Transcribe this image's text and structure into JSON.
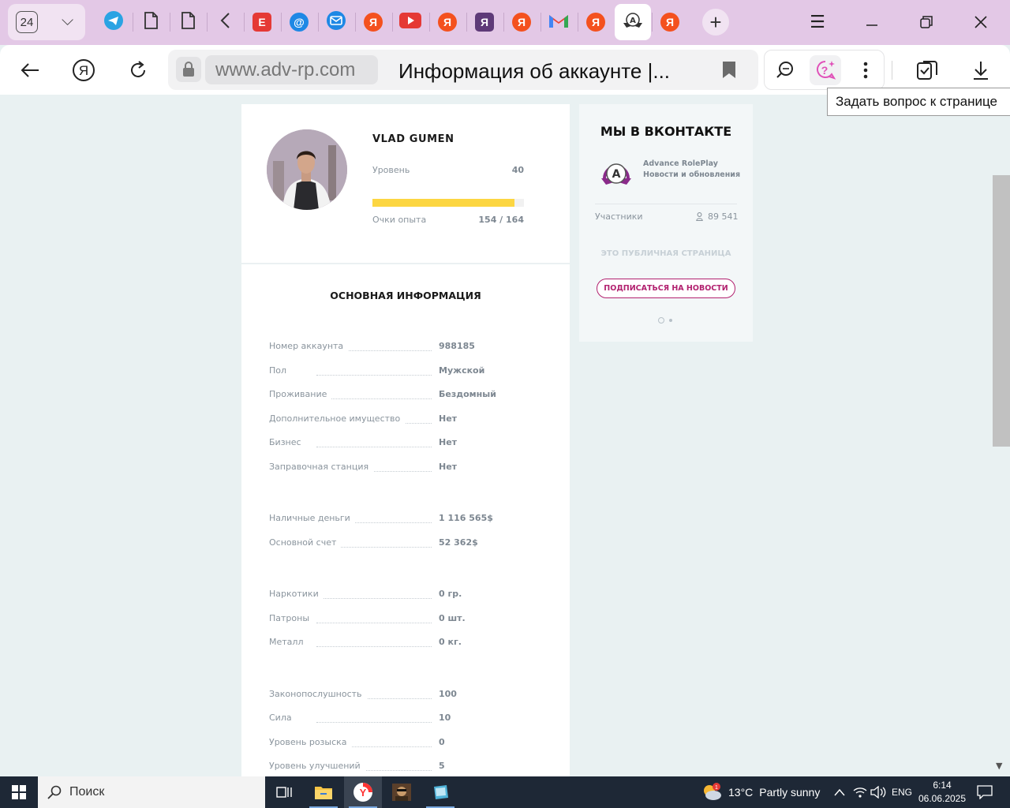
{
  "browser": {
    "tab_count": "24",
    "url": "www.adv-rp.com",
    "page_title": "Информация об аккаунте |...",
    "tooltip": "Задать вопрос к странице",
    "tabs": [
      {
        "icon": "telegram-icon",
        "color": "#2aa3e3"
      },
      {
        "icon": "document-icon",
        "color": "#333333"
      },
      {
        "icon": "document-icon",
        "color": "#333333"
      },
      {
        "icon": "back-chevron-icon",
        "color": "#333333"
      },
      {
        "icon": "e-letter-icon",
        "color": "#e53935",
        "glyph": "E"
      },
      {
        "icon": "at-sign-icon",
        "color": "#1e88e5",
        "glyph": "@"
      },
      {
        "icon": "mail-icon",
        "color": "#1e88e5"
      },
      {
        "icon": "yandex-icon",
        "color": "#f4511e",
        "glyph": "Я"
      },
      {
        "icon": "youtube-icon",
        "color": "#e53935"
      },
      {
        "icon": "yandex-icon",
        "color": "#f4511e",
        "glyph": "Я"
      },
      {
        "icon": "yandex-square-icon",
        "color": "#5e3a78",
        "glyph": "Я"
      },
      {
        "icon": "yandex-icon",
        "color": "#f4511e",
        "glyph": "Я"
      },
      {
        "icon": "gmail-icon",
        "color": "#e53935",
        "glyph": "M"
      },
      {
        "icon": "yandex-icon",
        "color": "#f4511e",
        "glyph": "Я"
      },
      {
        "icon": "advance-rp-icon",
        "color": "#333333",
        "glyph": "A",
        "active": true
      },
      {
        "icon": "yandex-icon",
        "color": "#f4511e",
        "glyph": "Я"
      }
    ]
  },
  "profile": {
    "name": "VLAD GUMEN",
    "level_label": "Уровень",
    "level_value": "40",
    "xp_label": "Очки опыта",
    "xp_value": "154 / 164",
    "xp_progress": 0.939
  },
  "info": {
    "title": "ОСНОВНАЯ ИНФОРМАЦИЯ",
    "groups": [
      [
        {
          "key": "Номер аккаунта",
          "value": "988185"
        },
        {
          "key": "Пол",
          "value": "Мужской"
        },
        {
          "key": "Проживание",
          "value": "Бездомный"
        },
        {
          "key": "Дополнительное имущество",
          "value": "Нет"
        },
        {
          "key": "Бизнес",
          "value": "Нет"
        },
        {
          "key": "Заправочная станция",
          "value": "Нет"
        }
      ],
      [
        {
          "key": "Наличные деньги",
          "value": "1 116 565$"
        },
        {
          "key": "Основной счет",
          "value": "52 362$"
        }
      ],
      [
        {
          "key": "Наркотики",
          "value": "0 гр."
        },
        {
          "key": "Патроны",
          "value": "0 шт."
        },
        {
          "key": "Металл",
          "value": "0 кг."
        }
      ],
      [
        {
          "key": "Законопослушность",
          "value": "100"
        },
        {
          "key": "Сила",
          "value": "10"
        },
        {
          "key": "Уровень розыска",
          "value": "0"
        },
        {
          "key": "Уровень улучшений",
          "value": "5"
        }
      ]
    ]
  },
  "vk": {
    "title": "МЫ В ВКОНТАКТЕ",
    "group_name": "Advance RolePlay",
    "group_sub": "Новости и обновления",
    "members_label": "Участники",
    "members_value": "89 541",
    "public_note": "ЭТО ПУБЛИЧНАЯ СТРАНИЦА",
    "subscribe_label": "ПОДПИСАТЬСЯ НА НОВОСТИ",
    "accent": "#b2216f"
  },
  "taskbar": {
    "search_placeholder": "Поиск",
    "weather_temp": "13°C",
    "weather_text": "Partly sunny",
    "lang": "ENG",
    "time": "6:14",
    "date": "06.06.2025"
  }
}
